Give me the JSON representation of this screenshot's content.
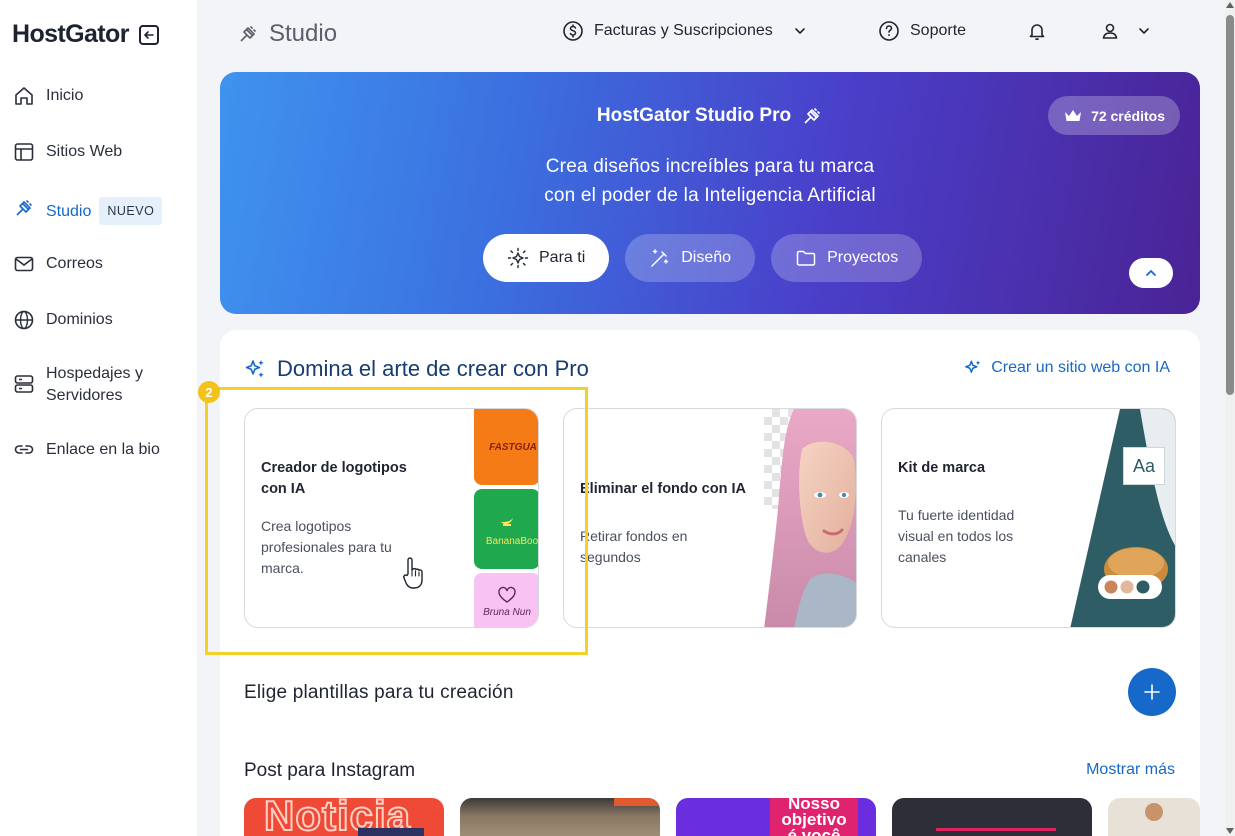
{
  "brand": {
    "logo": "HostGator"
  },
  "sidebar": {
    "items": [
      {
        "label": "Inicio",
        "icon": "home-icon"
      },
      {
        "label": "Sitios Web",
        "icon": "layout-icon"
      },
      {
        "label": "Studio",
        "icon": "studio-icon",
        "badge": "NUEVO",
        "active": true
      },
      {
        "label": "Correos",
        "icon": "mail-icon"
      },
      {
        "label": "Dominios",
        "icon": "globe-icon"
      },
      {
        "label": "Hospedajes y Servidores",
        "icon": "server-icon"
      },
      {
        "label": "Enlace en la bio",
        "icon": "link-icon"
      }
    ]
  },
  "header": {
    "title": "Studio",
    "billing": "Facturas y Suscripciones",
    "support": "Soporte"
  },
  "hero": {
    "title": "HostGator Studio Pro",
    "subtitle_line1": "Crea diseños increíbles para tu marca",
    "subtitle_line2": "con el poder de la Inteligencia Artificial",
    "credits": "72 créditos",
    "tabs": [
      {
        "label": "Para ti",
        "active": true
      },
      {
        "label": "Diseño"
      },
      {
        "label": "Proyectos"
      }
    ]
  },
  "section": {
    "title": "Domina el arte de crear con Pro",
    "link": "Crear un sitio web con IA",
    "step": "2",
    "cards": [
      {
        "title": "Creador de logotipos con IA",
        "desc": "Crea logotipos profesionales para tu marca."
      },
      {
        "title": "Eliminar el fondo con IA",
        "desc": "Retirar fondos en segundos"
      },
      {
        "title": "Kit de marca",
        "desc": "Tu fuerte identidad visual en todos los canales"
      }
    ],
    "logo_samples": [
      "FASTGUA",
      "BananaBoo",
      "Bruna Nun"
    ],
    "kit_sample_text": "Aa"
  },
  "templates": {
    "title": "Elige plantillas para tu creación",
    "instagram_title": "Post para Instagram",
    "show_more": "Mostrar más",
    "thumb1_text": "Noticia",
    "thumb3_text1": "Nosso",
    "thumb3_text2": "objetivo",
    "thumb3_text3": "é você"
  },
  "colors": {
    "accent": "#1769c9",
    "highlight": "#f2d12a",
    "hero_start": "#3f93ef",
    "hero_end": "#4a2395"
  }
}
